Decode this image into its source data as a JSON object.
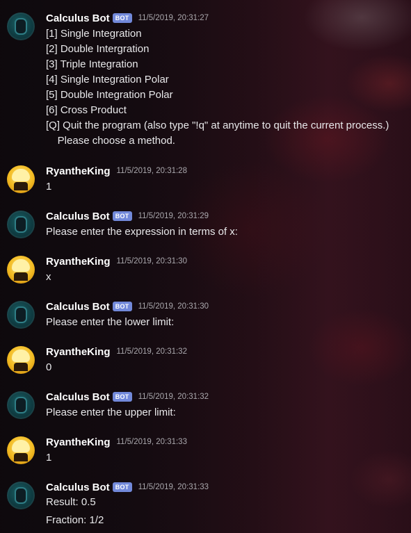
{
  "users": {
    "bot": {
      "name": "Calculus Bot",
      "tag": "BOT"
    },
    "user": {
      "name": "RyantheKing"
    }
  },
  "messages": [
    {
      "author": "bot",
      "timestamp": "11/5/2019, 20:31:27",
      "lines": [
        "[1] Single Integration",
        "[2] Double Intergration",
        "[3] Triple Integration",
        "[4] Single Integration Polar",
        "[5] Double Integration Polar",
        "[6] Cross Product",
        "[Q] Quit the program (also type \"!q\" at anytime to quit the current process.)",
        "    Please choose a method."
      ]
    },
    {
      "author": "user",
      "timestamp": "11/5/2019, 20:31:28",
      "lines": [
        "1"
      ]
    },
    {
      "author": "bot",
      "timestamp": "11/5/2019, 20:31:29",
      "lines": [
        "Please enter the expression in terms of x:"
      ]
    },
    {
      "author": "user",
      "timestamp": "11/5/2019, 20:31:30",
      "lines": [
        "x"
      ]
    },
    {
      "author": "bot",
      "timestamp": "11/5/2019, 20:31:30",
      "lines": [
        "Please enter the lower limit:"
      ]
    },
    {
      "author": "user",
      "timestamp": "11/5/2019, 20:31:32",
      "lines": [
        "0"
      ]
    },
    {
      "author": "bot",
      "timestamp": "11/5/2019, 20:31:32",
      "lines": [
        "Please enter the upper limit:"
      ]
    },
    {
      "author": "user",
      "timestamp": "11/5/2019, 20:31:33",
      "lines": [
        "1"
      ]
    },
    {
      "author": "bot",
      "timestamp": "11/5/2019, 20:31:33",
      "lines": [
        "Result: 0.5",
        "Fraction: 1/2"
      ]
    }
  ],
  "colors": {
    "bot_tag": "#7289da",
    "username": "#ffffff",
    "timestamp": "#aaa8ad",
    "text": "#e8e8ea"
  }
}
